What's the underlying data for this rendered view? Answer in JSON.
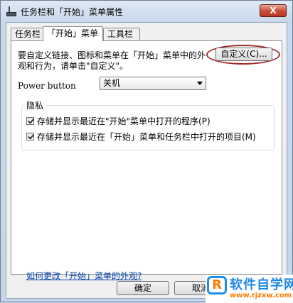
{
  "window": {
    "title": "任务栏和「开始」菜单属性",
    "close_symbol": "X"
  },
  "tabs": [
    {
      "label": "任务栏",
      "selected": false
    },
    {
      "label": "「开始」菜单",
      "selected": true
    },
    {
      "label": "工具栏",
      "selected": false
    }
  ],
  "start_menu": {
    "description": "要自定义链接、图标和菜单在「开始」菜单中的外观和行为，请单击\"自定义\"。",
    "customize_button": "自定义(C)...",
    "power_button_label": "Power button",
    "power_button_value": "关机"
  },
  "privacy": {
    "group_label": "隐私",
    "checkboxes": [
      {
        "label": "存储并显示最近在\"开始\"菜单中打开的程序(P)",
        "checked": true
      },
      {
        "label": "存储并显示最近在「开始」菜单和任务栏中打开的项目(M)",
        "checked": true
      }
    ]
  },
  "help_link": "如何更改「开始」菜单的外观?",
  "buttons": {
    "ok": "确定",
    "cancel": "取消"
  },
  "watermark": {
    "logo": "R",
    "name": "软件自学网",
    "url": "www.rjzxw.com"
  },
  "colors": {
    "highlight_ellipse": "#a52a2a",
    "link": "#0645ad",
    "close_button": "#c94a34"
  }
}
